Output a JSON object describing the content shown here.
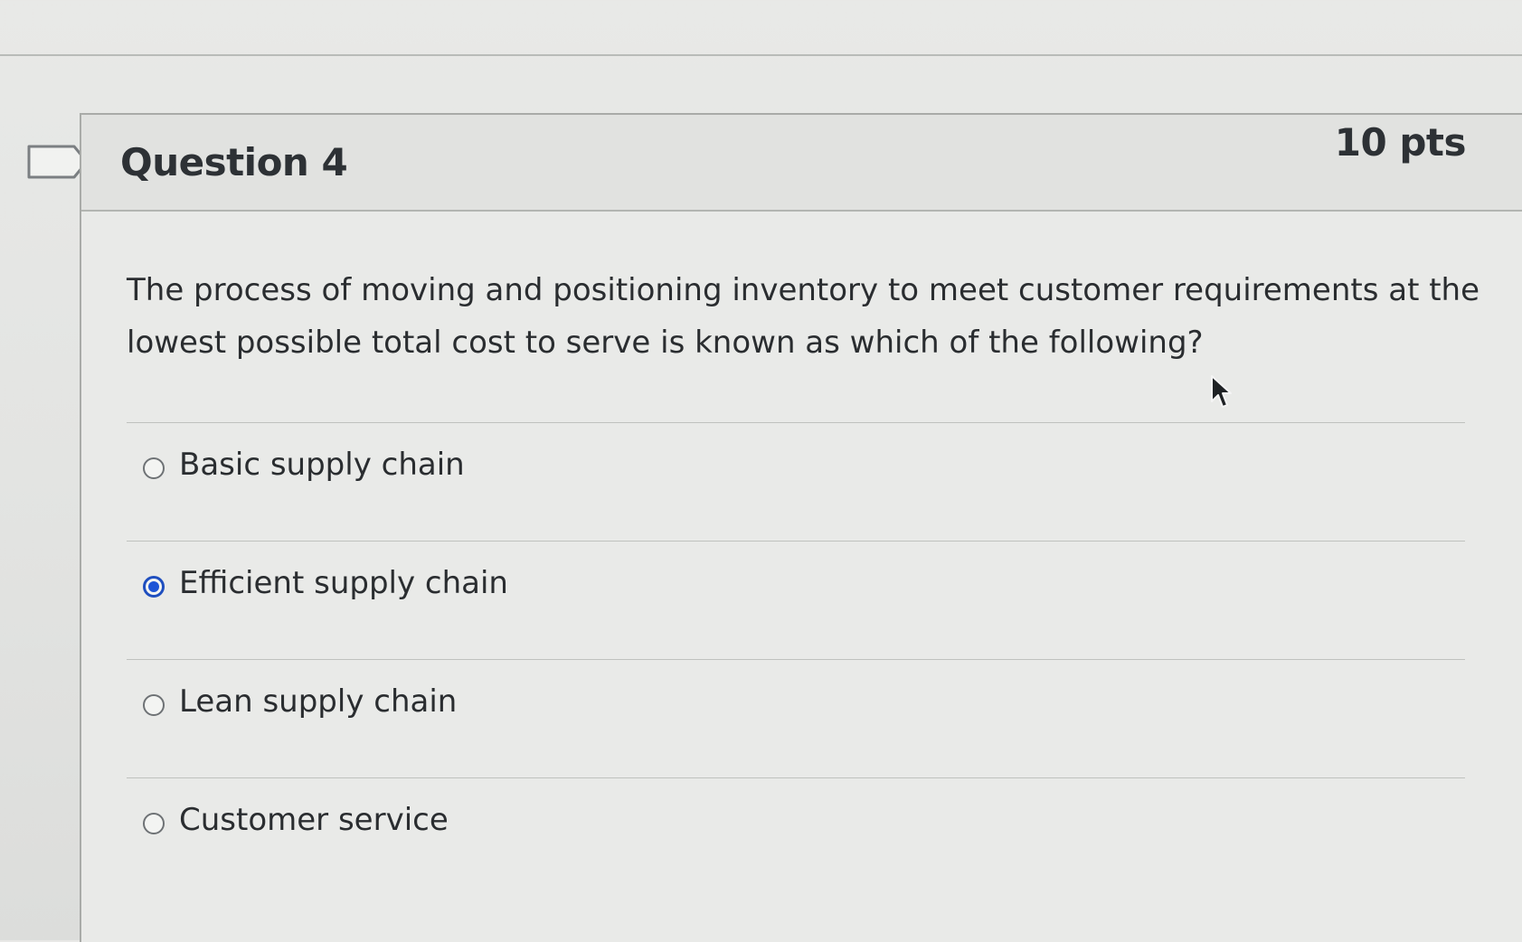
{
  "question": {
    "title": "Question 4",
    "points": "10 pts",
    "text": "The process of moving and positioning inventory to meet customer requirements at the lowest possible total cost to serve is known as which of the following?"
  },
  "answers": [
    {
      "label": "Basic supply chain",
      "selected": false
    },
    {
      "label": "Efficient supply chain",
      "selected": true
    },
    {
      "label": "Lean supply chain",
      "selected": false
    },
    {
      "label": "Customer service",
      "selected": false
    }
  ],
  "icons": {
    "flag": "flag-icon",
    "cursor": "mouse-pointer-icon"
  },
  "colors": {
    "selected_radio": "#1e55d6"
  }
}
